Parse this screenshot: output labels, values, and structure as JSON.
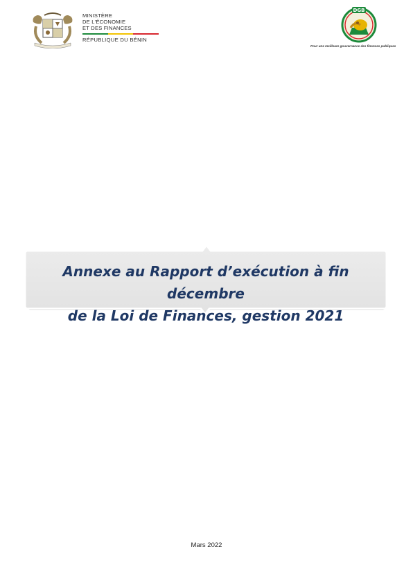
{
  "header": {
    "ministry_line1": "MINISTÈRE",
    "ministry_line2": "DE L'ÉCONOMIE",
    "ministry_line3": "ET DES FINANCES",
    "country": "RÉPUBLIQUE DU BÉNIN",
    "coat_of_arms_motto": "FRATERNITÉ · JUSTICE · TRAVAIL",
    "flag_colors": [
      "#1c8a3b",
      "#f3c300",
      "#d7262d"
    ],
    "dgb_logo_text": "DGB",
    "dgb_slogan": "Pour une meilleure gouvernance  des finances publiques"
  },
  "banner": {
    "title_line1": "Annexe au Rapport d’exécution à fin décembre",
    "title_line2": "de la Loi de Finances, gestion 2021",
    "title_color": "#1f3864"
  },
  "footer": {
    "date": "Mars 2022"
  }
}
